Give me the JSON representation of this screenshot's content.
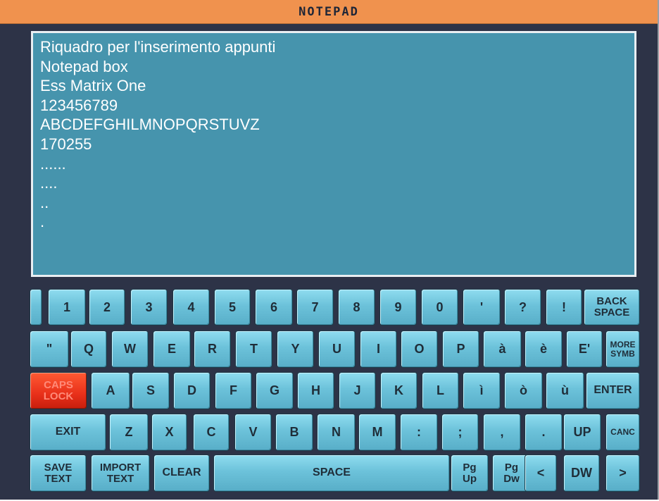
{
  "title": "NOTEPAD",
  "notepad_lines": [
    "Riquadro per l'inserimento appunti",
    "Notepad box",
    "Ess Matrix One",
    "123456789",
    "ABCDEFGHILMNOPQRSTUVZ",
    "170255",
    "......",
    "....",
    "..",
    "."
  ],
  "keyboard": {
    "row1": [
      "",
      "1",
      "2",
      "3",
      "4",
      "5",
      "6",
      "7",
      "8",
      "9",
      "0",
      "'",
      "?",
      "!",
      "BACK\nSPACE"
    ],
    "row2": [
      "\"",
      "Q",
      "W",
      "E",
      "R",
      "T",
      "Y",
      "U",
      "I",
      "O",
      "P",
      "à",
      "è",
      "E'",
      "MORE\nSYMB"
    ],
    "row3": [
      "CAPS\nLOCK",
      "A",
      "S",
      "D",
      "F",
      "G",
      "H",
      "J",
      "K",
      "L",
      "ì",
      "ò",
      "ù",
      "ENTER"
    ],
    "row4": [
      "EXIT",
      "Z",
      "X",
      "C",
      "V",
      "B",
      "N",
      "M",
      ":",
      ";",
      ",",
      ".",
      "UP",
      "CANC"
    ],
    "row5": [
      "SAVE\nTEXT",
      "IMPORT\nTEXT",
      "CLEAR",
      "SPACE",
      "Pg\nUp",
      "Pg\nDw",
      "<",
      "DW",
      ">"
    ]
  },
  "colors": {
    "title_bar": "#f0924e",
    "background": "#2d3347",
    "notepad_bg": "#4694ad",
    "key": "#6cc2da",
    "caps_lock_active": "#e8301a"
  }
}
